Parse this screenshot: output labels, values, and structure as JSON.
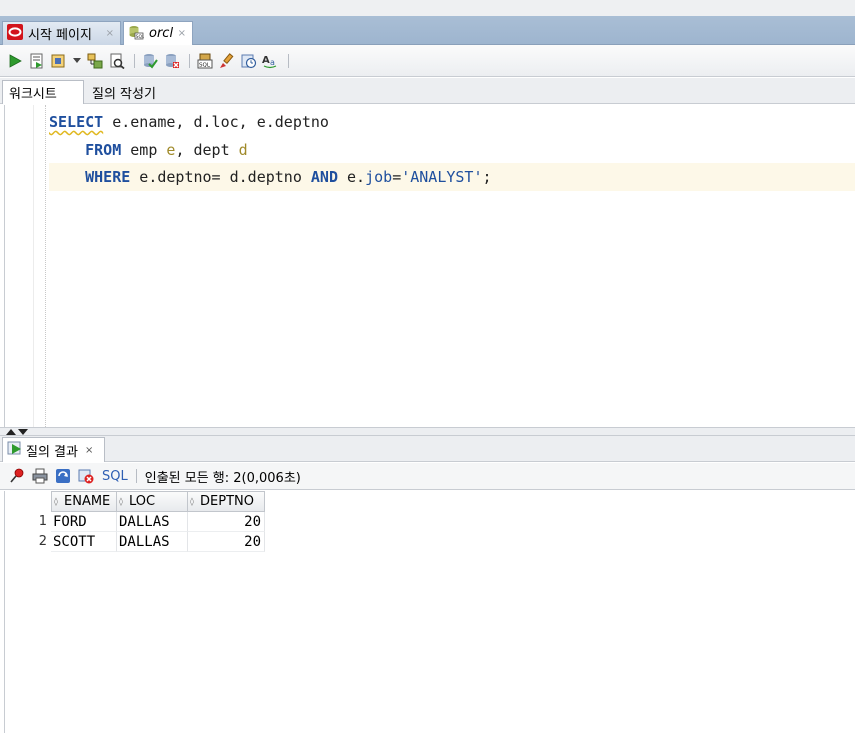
{
  "doc_tabs": [
    {
      "label": "시작 페이지",
      "close": "×",
      "icon": "oracle-logo-icon"
    },
    {
      "label": "orcl",
      "close": "×",
      "icon": "sql-connection-icon"
    }
  ],
  "toolbar": {
    "icons": [
      "run-statement-icon",
      "run-script-icon",
      "autotrace-icon",
      "dropdown-caret-icon",
      "explain-plan-icon",
      "sql-tuning-icon",
      "commit-icon",
      "rollback-icon",
      "unshared-sql-icon",
      "clear-icon",
      "sql-history-icon",
      "format-case-icon"
    ]
  },
  "sub_tabs": [
    {
      "label": "워크시트",
      "active": true
    },
    {
      "label": "질의 작성기",
      "active": false
    }
  ],
  "editor": {
    "lines": [
      [
        {
          "t": "SELECT",
          "c": "kw ul"
        },
        {
          "t": " e.ename, d.loc, e.deptno",
          "c": "id"
        }
      ],
      [
        {
          "t": "    ",
          "c": "id"
        },
        {
          "t": "FROM",
          "c": "kw"
        },
        {
          "t": " emp ",
          "c": "id"
        },
        {
          "t": "e",
          "c": "alias"
        },
        {
          "t": ", dept ",
          "c": "id"
        },
        {
          "t": "d",
          "c": "alias"
        }
      ],
      [
        {
          "t": "    ",
          "c": "id"
        },
        {
          "t": "WHERE",
          "c": "kw"
        },
        {
          "t": " e.deptno= d.deptno ",
          "c": "id"
        },
        {
          "t": "AND",
          "c": "kw"
        },
        {
          "t": " e.",
          "c": "id"
        },
        {
          "t": "job",
          "c": "str"
        },
        {
          "t": "=",
          "c": "id"
        },
        {
          "t": "'ANALYST'",
          "c": "str"
        },
        {
          "t": ";",
          "c": "id"
        }
      ]
    ]
  },
  "result_tab": {
    "label": "질의 결과",
    "close": "×"
  },
  "result_toolbar": {
    "sql_link": "SQL",
    "status": "인출된 모든 행: 2(0,006초)"
  },
  "grid": {
    "columns": [
      "ENAME",
      "LOC",
      "DEPTNO"
    ],
    "rows": [
      {
        "num": "1",
        "cells": [
          "FORD",
          "DALLAS",
          "20"
        ]
      },
      {
        "num": "2",
        "cells": [
          "SCOTT",
          "DALLAS",
          "20"
        ]
      }
    ]
  },
  "colors": {
    "keyword": "#1f4f9e",
    "alias": "#a08a2a",
    "current_line": "#fdf8e8",
    "tabbar": "#a9bed5"
  }
}
